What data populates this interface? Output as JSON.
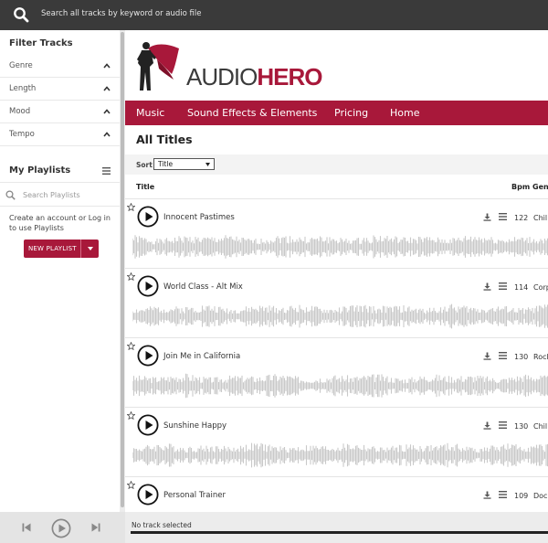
{
  "search": {
    "placeholder": "Search all tracks by keyword or audio file",
    "icon": "search-icon"
  },
  "sidebar": {
    "filter_title": "Filter Tracks",
    "filters": [
      {
        "label": "Genre"
      },
      {
        "label": "Length"
      },
      {
        "label": "Mood"
      },
      {
        "label": "Tempo"
      }
    ],
    "playlists_title": "My Playlists",
    "playlist_search_placeholder": "Search Playlists",
    "note_pre": "Create an account",
    "note_or": " or ",
    "note_login": "Log in",
    "note_post": "to use Playlists",
    "new_playlist_label": "NEW PLAYLIST"
  },
  "brand": {
    "part1": "AUDIO",
    "part2": "HERO",
    "accent_color": "#a8183a"
  },
  "nav": {
    "items": [
      "Music",
      "Sound Effects & Elements",
      "Pricing",
      "Home"
    ]
  },
  "main": {
    "heading": "All Titles",
    "sort_label": "Sort",
    "sort_value": "Title",
    "columns": {
      "title": "Title",
      "bpm": "Bpm",
      "genre": "Gen"
    }
  },
  "tracks": [
    {
      "title": "Innocent Pastimes",
      "bpm": "122",
      "genre": "Chil"
    },
    {
      "title": "World Class - Alt Mix",
      "bpm": "114",
      "genre": "Corp"
    },
    {
      "title": "Join Me in California",
      "bpm": "130",
      "genre": "Rock"
    },
    {
      "title": "Sunshine Happy",
      "bpm": "130",
      "genre": "Chil"
    },
    {
      "title": "Personal Trainer",
      "bpm": "109",
      "genre": "Docu"
    }
  ],
  "player": {
    "status": "No track selected"
  }
}
